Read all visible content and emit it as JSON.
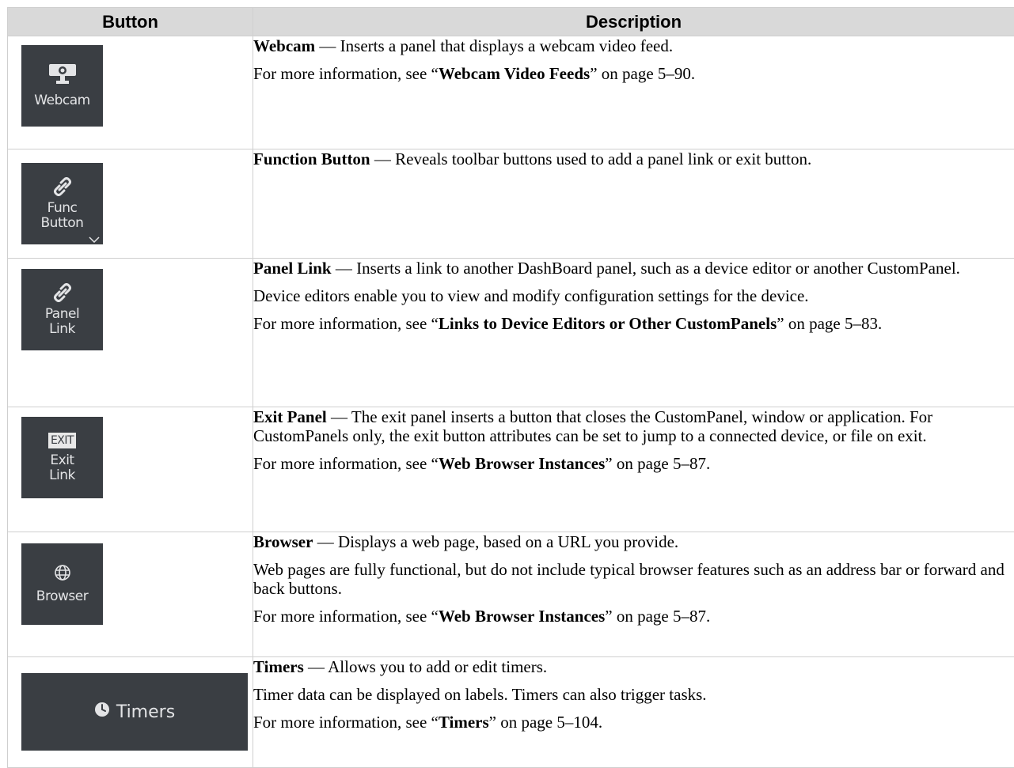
{
  "header": {
    "col_button": "Button",
    "col_description": "Description"
  },
  "rows": [
    {
      "icon": "webcam-icon",
      "button_label": "Webcam",
      "title": "Webcam",
      "summary": " — Inserts a panel that displays a webcam video feed.",
      "more_pre": "For more information, see “",
      "more_link": "Webcam Video Feeds",
      "more_post": "” on page 5–90."
    },
    {
      "icon": "link-icon",
      "button_label_1": "Func",
      "button_label_2": "Button",
      "title": "Function Button",
      "summary": " — Reveals toolbar buttons used to add a panel link or exit button."
    },
    {
      "icon": "link-icon",
      "button_label_1": "Panel",
      "button_label_2": "Link",
      "title": "Panel Link",
      "summary": " — Inserts a link to another DashBoard panel, such as a device editor or another CustomPanel.",
      "para2": "Device editors enable you to view and modify configuration settings for the device.",
      "more_pre": "For more information, see “",
      "more_link": "Links to Device Editors or Other CustomPanels",
      "more_post": "” on page 5–83."
    },
    {
      "icon": "exit-badge-icon",
      "badge": "EXIT",
      "button_label_1": "Exit",
      "button_label_2": "Link",
      "title": "Exit Panel",
      "summary": " — The exit panel inserts a button that closes the CustomPanel, window or application. For CustomPanels only, the exit button attributes can be set to jump to a connected device, or file on exit.",
      "more_pre": "For more information, see “",
      "more_link": "Web Browser Instances",
      "more_post": "” on page 5–87."
    },
    {
      "icon": "globe-icon",
      "button_label": "Browser",
      "title": "Browser",
      "summary": " — Displays a web page, based on a URL you provide.",
      "para2": "Web pages are fully functional, but do not include typical browser features such as an address bar or forward and back buttons.",
      "more_pre": "For more information, see “",
      "more_link": "Web Browser Instances",
      "more_post": "” on page 5–87."
    },
    {
      "icon": "clock-icon",
      "button_label": "Timers",
      "title": "Timers",
      "summary": " — Allows you to add or edit timers.",
      "para2": "Timer data can be displayed on labels. Timers can also trigger tasks.",
      "more_pre": "For more information, see “",
      "more_link": "Timers",
      "more_post": "” on page 5–104."
    }
  ],
  "colors": {
    "button_bg": "#3a3e43",
    "button_text": "#e3e4e6",
    "header_bg": "#d9d9d9"
  }
}
